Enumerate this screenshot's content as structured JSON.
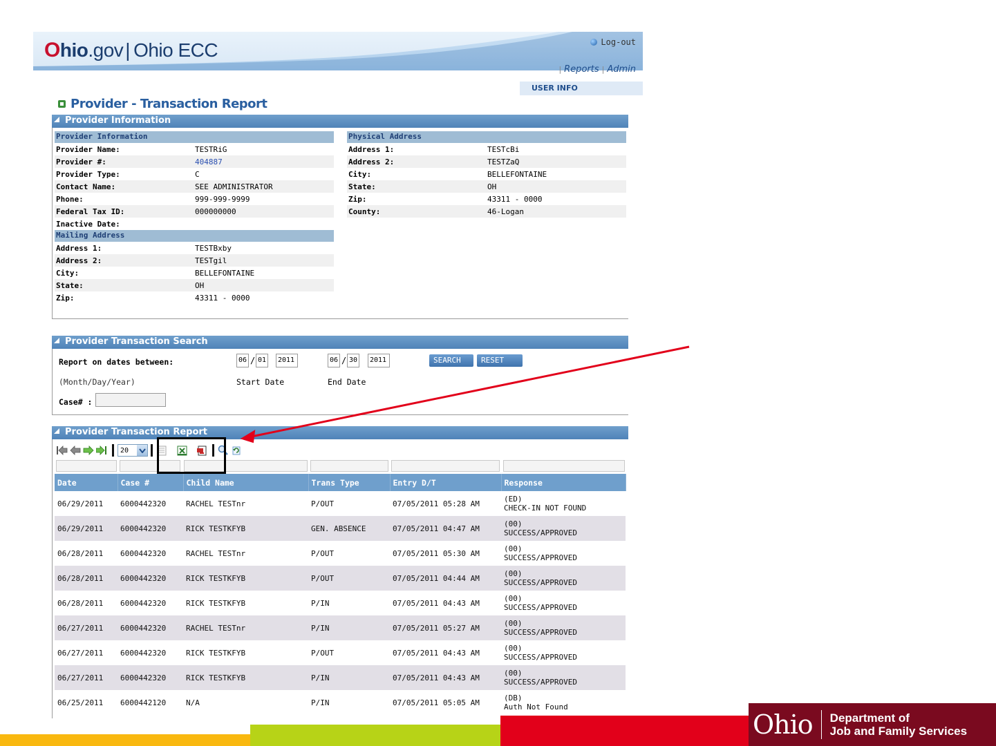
{
  "header": {
    "logo_o": "O",
    "logo_hio": "hio",
    "logo_gov": ".gov",
    "logo_sep": "|",
    "logo_ecc": "Ohio ECC",
    "logout": "Log-out"
  },
  "nav": {
    "reports": "Reports",
    "admin": "Admin",
    "user_info": "USER INFO"
  },
  "page_title": "Provider - Transaction Report",
  "provider_section": {
    "title": "Provider Information",
    "provider_info": {
      "header": "Provider Information",
      "rows": [
        {
          "label": "Provider Name:",
          "value": "TESTRiG"
        },
        {
          "label": "Provider #:",
          "value": "404887"
        },
        {
          "label": "Provider Type:",
          "value": "C"
        },
        {
          "label": "Contact Name:",
          "value": "SEE ADMINISTRATOR"
        },
        {
          "label": "Phone:",
          "value": "999-999-9999"
        },
        {
          "label": "Federal Tax ID:",
          "value": "000000000"
        },
        {
          "label": "Inactive Date:",
          "value": ""
        }
      ]
    },
    "mailing_address": {
      "header": "Mailing Address",
      "rows": [
        {
          "label": "Address 1:",
          "value": "TESTBxby"
        },
        {
          "label": "Address 2:",
          "value": "TESTgil"
        },
        {
          "label": "City:",
          "value": "BELLEFONTAINE"
        },
        {
          "label": "State:",
          "value": "OH"
        },
        {
          "label": "Zip:",
          "value": "43311 - 0000"
        }
      ]
    },
    "physical_address": {
      "header": "Physical Address",
      "rows": [
        {
          "label": "Address 1:",
          "value": "TESTcBi"
        },
        {
          "label": "Address 2:",
          "value": "TESTZaQ"
        },
        {
          "label": "City:",
          "value": "BELLEFONTAINE"
        },
        {
          "label": "State:",
          "value": "OH"
        },
        {
          "label": "Zip:",
          "value": "43311 - 0000"
        },
        {
          "label": "County:",
          "value": "46-Logan"
        }
      ]
    }
  },
  "search_section": {
    "title": "Provider Transaction Search",
    "report_label": "Report on dates between:",
    "format_label": "(Month/Day/Year)",
    "start_month": "06",
    "start_day": "01",
    "start_year": "2011",
    "end_month": "06",
    "end_day": "30",
    "end_year": "2011",
    "start_caption": "Start Date",
    "end_caption": "End Date",
    "slash": "/",
    "search_button": "SEARCH",
    "reset_button": "RESET",
    "case_label": "Case# :",
    "case_value": ""
  },
  "report_section": {
    "title": "Provider Transaction Report",
    "page_size": "20",
    "columns": [
      "Date",
      "Case #",
      "Child Name",
      "Trans Type",
      "Entry D/T",
      "Response"
    ],
    "rows": [
      {
        "date": "06/29/2011",
        "case": "6000442320",
        "child": "RACHEL TESTnr",
        "type": "P/OUT",
        "entry": "07/05/2011 05:28 AM",
        "code": "(ED)",
        "resp": "CHECK-IN NOT FOUND"
      },
      {
        "date": "06/29/2011",
        "case": "6000442320",
        "child": "RICK TESTKFYB",
        "type": "GEN. ABSENCE",
        "entry": "07/05/2011 04:47 AM",
        "code": "(00)",
        "resp": "SUCCESS/APPROVED"
      },
      {
        "date": "06/28/2011",
        "case": "6000442320",
        "child": "RACHEL TESTnr",
        "type": "P/OUT",
        "entry": "07/05/2011 05:30 AM",
        "code": "(00)",
        "resp": "SUCCESS/APPROVED"
      },
      {
        "date": "06/28/2011",
        "case": "6000442320",
        "child": "RICK TESTKFYB",
        "type": "P/OUT",
        "entry": "07/05/2011 04:44 AM",
        "code": "(00)",
        "resp": "SUCCESS/APPROVED"
      },
      {
        "date": "06/28/2011",
        "case": "6000442320",
        "child": "RICK TESTKFYB",
        "type": "P/IN",
        "entry": "07/05/2011 04:43 AM",
        "code": "(00)",
        "resp": "SUCCESS/APPROVED"
      },
      {
        "date": "06/27/2011",
        "case": "6000442320",
        "child": "RACHEL TESTnr",
        "type": "P/IN",
        "entry": "07/05/2011 05:27 AM",
        "code": "(00)",
        "resp": "SUCCESS/APPROVED"
      },
      {
        "date": "06/27/2011",
        "case": "6000442320",
        "child": "RICK TESTKFYB",
        "type": "P/OUT",
        "entry": "07/05/2011 04:43 AM",
        "code": "(00)",
        "resp": "SUCCESS/APPROVED"
      },
      {
        "date": "06/27/2011",
        "case": "6000442320",
        "child": "RICK TESTKFYB",
        "type": "P/IN",
        "entry": "07/05/2011 04:43 AM",
        "code": "(00)",
        "resp": "SUCCESS/APPROVED"
      },
      {
        "date": "06/25/2011",
        "case": "6000442120",
        "child": "N/A",
        "type": "P/IN",
        "entry": "07/05/2011 05:05 AM",
        "code": "(DB)",
        "resp": "Auth Not Found"
      }
    ]
  },
  "branding": {
    "ohio": "Ohio",
    "dept_line1": "Department of",
    "dept_line2": "Job and Family Services"
  },
  "colors": {
    "section_header": "#5b8fc2",
    "subheader": "#9fbcd4",
    "title_blue": "#2a5fa0",
    "annotation_arrow": "#e2001a",
    "brand_maroon": "#7a0a1f",
    "bar_yellow": "#f9b80f",
    "bar_green": "#b7d317",
    "bar_red": "#e2001a"
  },
  "icons": [
    "first-page-icon",
    "prev-page-icon",
    "next-page-icon",
    "last-page-icon",
    "page-size-dropdown-icon",
    "export-list-icon",
    "export-excel-icon",
    "export-pdf-icon",
    "find-icon",
    "refresh-icon",
    "logout-icon"
  ]
}
